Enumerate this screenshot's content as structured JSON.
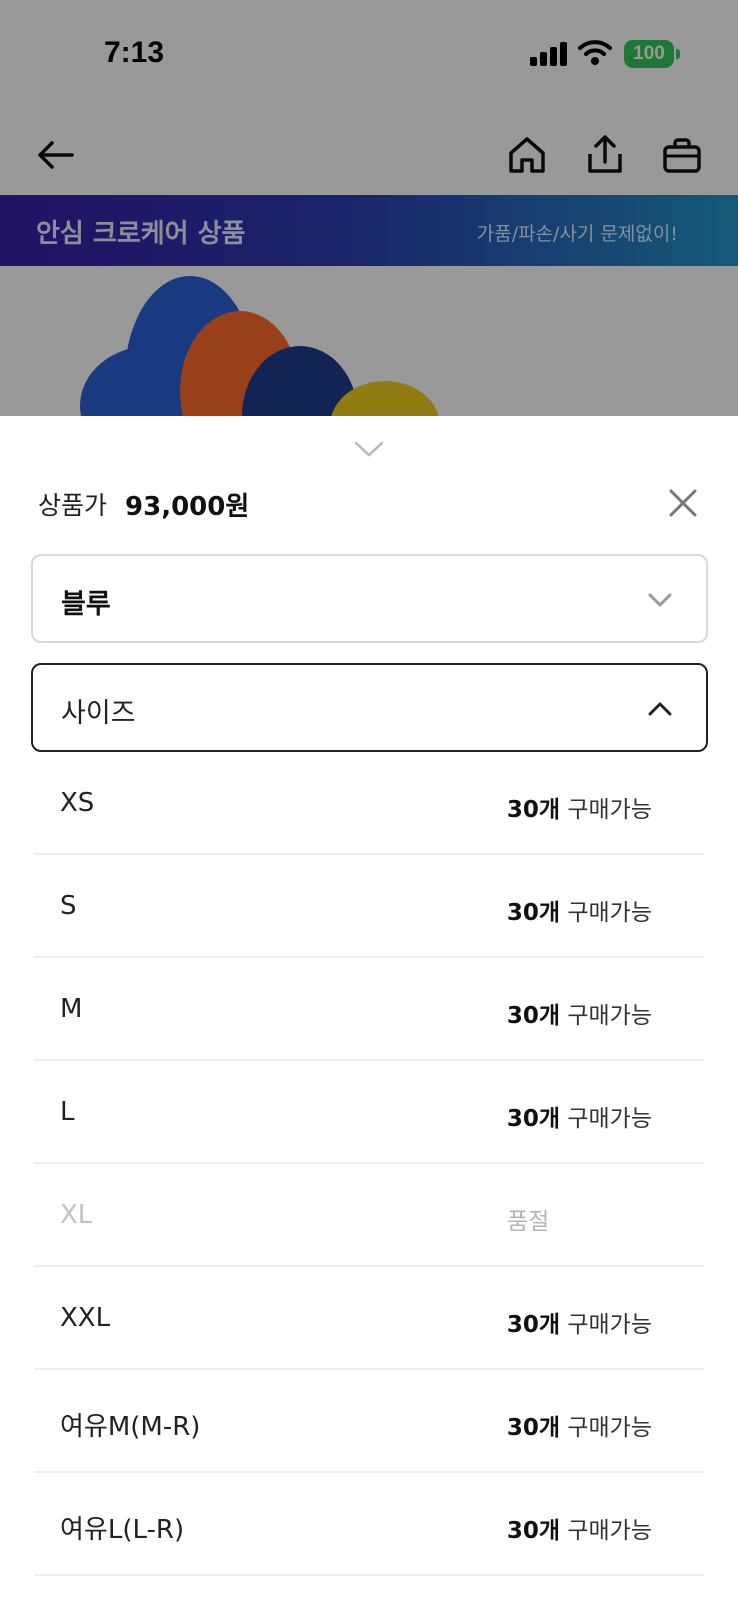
{
  "status_bar": {
    "time": "7:13",
    "battery": "100",
    "battery_color": "#34c759"
  },
  "top_nav": {
    "back_icon": "arrow-left-icon",
    "home_icon": "home-icon",
    "share_icon": "share-icon",
    "cart_icon": "shopping-bag-icon"
  },
  "promo_banner": {
    "title": "안심 크로케어 상품",
    "subtitle": "가품/파손/사기 문제없이!"
  },
  "sheet": {
    "collapse_icon": "chevron-down-icon",
    "price_label": "상품가",
    "price_value": "93,000원",
    "close_icon": "close-icon",
    "color_select": {
      "value": "블루",
      "icon": "chevron-down-icon"
    },
    "size_select": {
      "placeholder": "사이즈",
      "icon": "chevron-up-icon"
    },
    "options": [
      {
        "name": "XS",
        "qty": "30개",
        "status": "구매가능"
      },
      {
        "name": "S",
        "qty": "30개",
        "status": "구매가능"
      },
      {
        "name": "M",
        "qty": "30개",
        "status": "구매가능"
      },
      {
        "name": "L",
        "qty": "30개",
        "status": "구매가능"
      },
      {
        "name": "XL",
        "soldout": "품절"
      },
      {
        "name": "XXL",
        "qty": "30개",
        "status": "구매가능"
      },
      {
        "name": "여유M(M-R)",
        "qty": "30개",
        "status": "구매가능"
      },
      {
        "name": "여유L(L-R)",
        "qty": "30개",
        "status": "구매가능"
      }
    ]
  }
}
